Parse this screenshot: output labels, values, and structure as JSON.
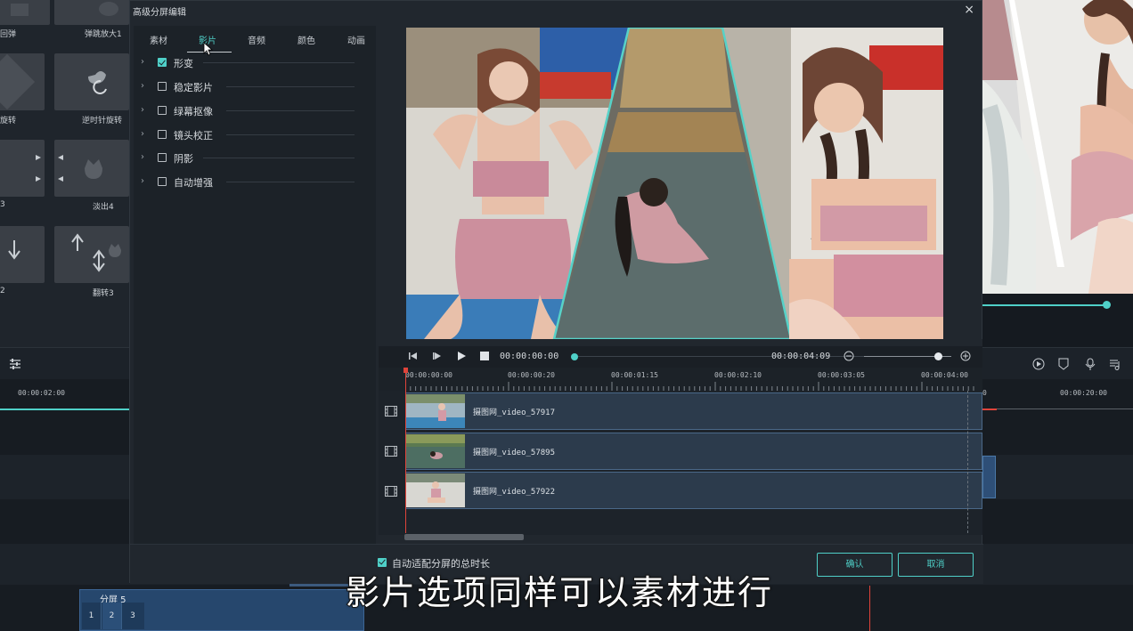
{
  "background_app": {
    "effect_tiles": [
      {
        "label": "回弹"
      },
      {
        "label": "弹跳放大1"
      },
      {
        "label": "旋转"
      },
      {
        "label": "逆时针旋转"
      },
      {
        "label": "3"
      },
      {
        "label": "淡出4"
      },
      {
        "label": "2"
      },
      {
        "label": "翻转3"
      }
    ],
    "timeline_left_time": "00:00:02:00",
    "timeline_right_time": "00:00:20:00",
    "timeline_right_time_partial": "0",
    "clip": {
      "label": "分屏 5",
      "cells": [
        "1",
        "2",
        "3"
      ]
    }
  },
  "dialog": {
    "title": "高级分屏编辑",
    "close_glyph": "×",
    "tabs": [
      {
        "label": "素材",
        "active": false
      },
      {
        "label": "影片",
        "active": true
      },
      {
        "label": "音频",
        "active": false
      },
      {
        "label": "颜色",
        "active": false
      },
      {
        "label": "动画",
        "active": false
      }
    ],
    "options": [
      {
        "label": "形变",
        "checked": true
      },
      {
        "label": "稳定影片",
        "checked": false
      },
      {
        "label": "绿幕抠像",
        "checked": false
      },
      {
        "label": "镜头校正",
        "checked": false
      },
      {
        "label": "阴影",
        "checked": false
      },
      {
        "label": "自动增强",
        "checked": false
      }
    ],
    "playback": {
      "current_time": "00:00:00:00",
      "total_time": "00:00:04:09",
      "zoom_level": 0.85
    },
    "ruler_labels": [
      "00:00:00:00",
      "00:00:00:20",
      "00:00:01:15",
      "00:00:02:10",
      "00:00:03:05",
      "00:00:04:00"
    ],
    "tracks": [
      {
        "name": "摄图网_video_57917"
      },
      {
        "name": "摄图网_video_57895"
      },
      {
        "name": "摄图网_video_57922"
      }
    ],
    "footer": {
      "auto_fit_label": "自动适配分屏的总时长",
      "auto_fit_checked": true,
      "confirm_label": "确认",
      "cancel_label": "取消"
    }
  },
  "subtitle": "影片选项同样可以素材进行",
  "colors": {
    "accent": "#4fd0c8",
    "dialog_bg": "#21272e",
    "track_bg": "#2c3b4c",
    "playhead": "#e0443b"
  }
}
